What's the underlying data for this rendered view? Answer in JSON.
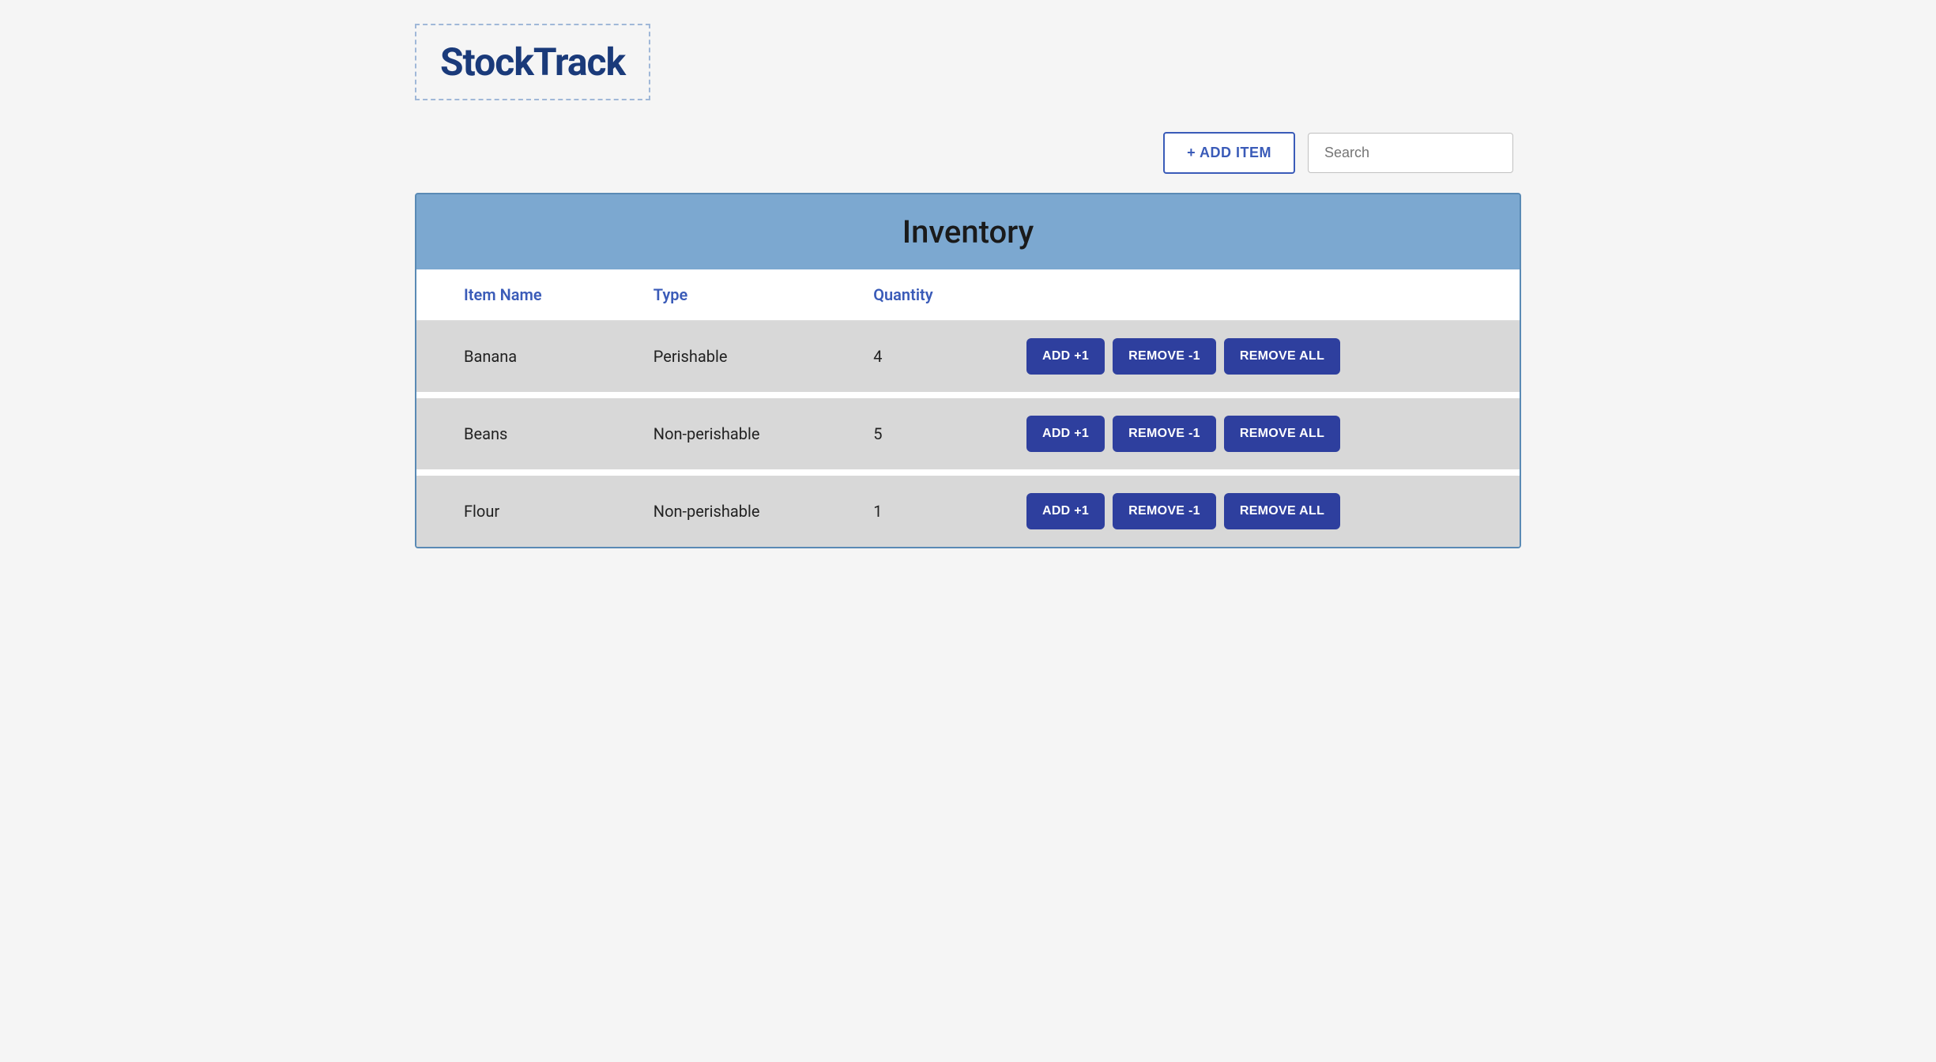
{
  "app": {
    "logo": "StockTrack"
  },
  "toolbar": {
    "add_item_label": "+ ADD ITEM",
    "search_placeholder": "Search"
  },
  "inventory": {
    "title": "Inventory",
    "columns": [
      {
        "key": "name",
        "label": "Item Name"
      },
      {
        "key": "type",
        "label": "Type"
      },
      {
        "key": "quantity",
        "label": "Quantity"
      }
    ],
    "rows": [
      {
        "id": 1,
        "name": "Banana",
        "type": "Perishable",
        "quantity": 4
      },
      {
        "id": 2,
        "name": "Beans",
        "type": "Non-perishable",
        "quantity": 5
      },
      {
        "id": 3,
        "name": "Flour",
        "type": "Non-perishable",
        "quantity": 1
      }
    ],
    "buttons": {
      "add": "ADD +1",
      "remove_one": "REMOVE -1",
      "remove_all": "REMOVE ALL"
    }
  }
}
